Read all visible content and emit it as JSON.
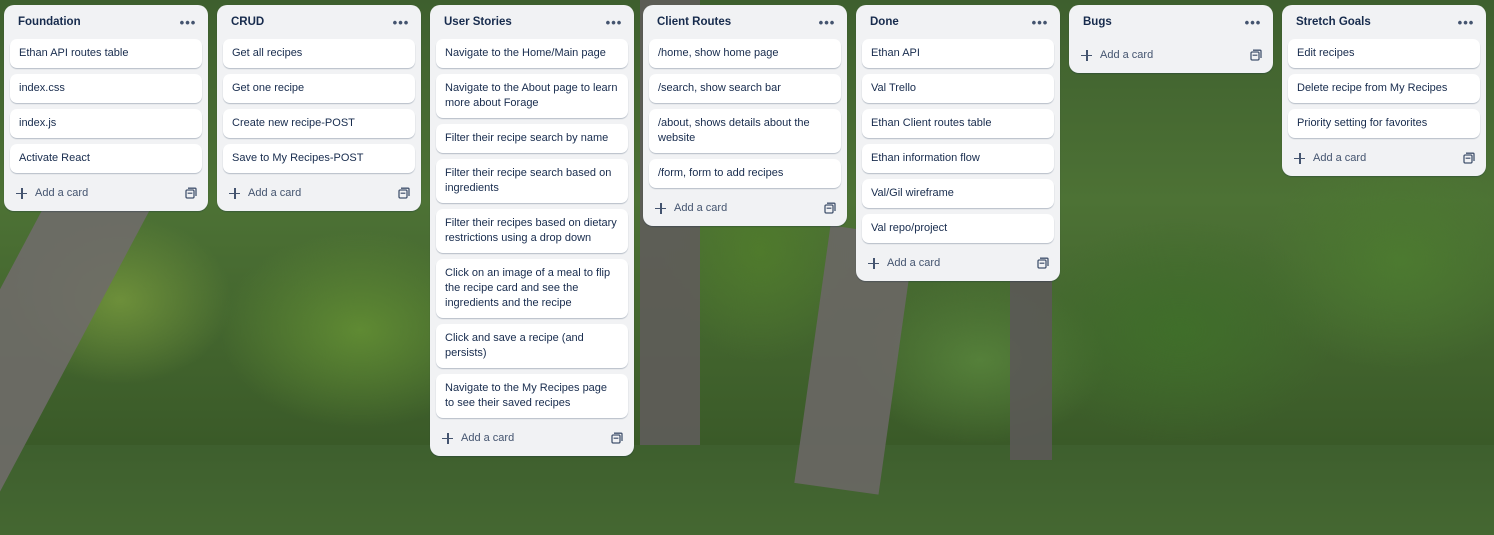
{
  "board": {
    "add_card_label": "Add a card",
    "lists": [
      {
        "title": "Foundation",
        "cards": [
          "Ethan API routes table",
          "index.css",
          "index.js",
          "Activate React"
        ]
      },
      {
        "title": "CRUD",
        "cards": [
          "Get all recipes",
          "Get one recipe",
          "Create new recipe-POST",
          "Save to My Recipes-POST"
        ]
      },
      {
        "title": "User Stories",
        "cards": [
          "Navigate to the Home/Main page",
          "Navigate to the About page to learn more about Forage",
          "Filter their recipe search by name",
          "Filter their recipe search based on ingredients",
          "Filter their recipes based on dietary restrictions using a drop down",
          "Click on an image of a meal to flip the recipe card and see the ingredients and the recipe",
          "Click and save a recipe (and persists)",
          "Navigate to the My Recipes page to see their saved recipes"
        ]
      },
      {
        "title": "Client Routes",
        "cards": [
          "/home, show home page",
          "/search, show search bar",
          "/about, shows details about the website",
          "/form, form to add recipes"
        ]
      },
      {
        "title": "Done",
        "cards": [
          "Ethan API",
          "Val Trello",
          "Ethan Client routes table",
          "Ethan information flow",
          "Val/Gil wireframe",
          "Val repo/project"
        ]
      },
      {
        "title": "Bugs",
        "cards": []
      },
      {
        "title": "Stretch Goals",
        "cards": [
          "Edit recipes",
          "Delete recipe from My Recipes",
          "Priority setting for favorites"
        ]
      }
    ]
  },
  "icons": {
    "list_menu": "more-horizontal-icon",
    "add": "plus-icon",
    "template": "card-template-icon"
  }
}
